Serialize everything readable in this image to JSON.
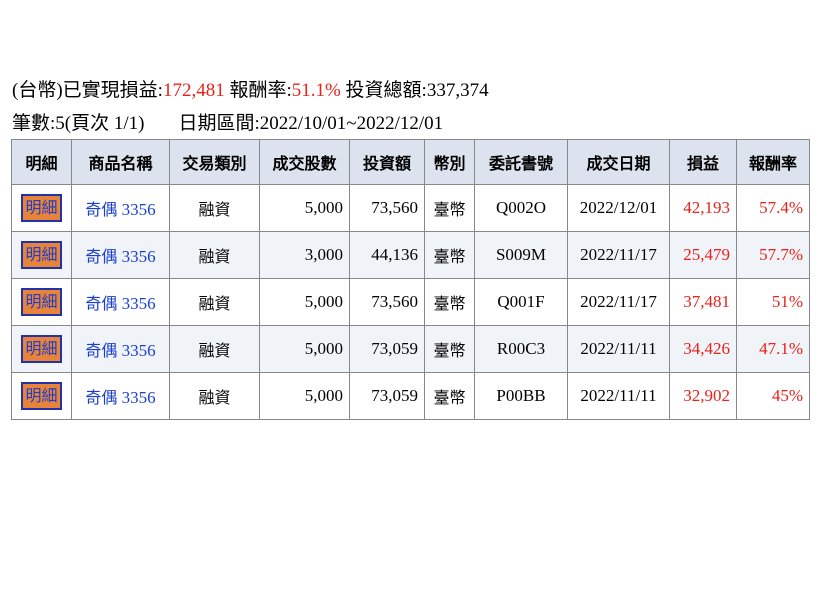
{
  "summary": {
    "realized_label": "(台幣)已實現損益:",
    "realized_value": "172,481",
    "return_label": " 報酬率:",
    "return_value": "51.1%",
    "invest_label": " 投資總額:",
    "invest_value": "337,374",
    "count_label": "筆數:5(頁次 1/1)",
    "period_label": "日期區間:2022/10/01~2022/12/01"
  },
  "table": {
    "headers": [
      "明細",
      "商品名稱",
      "交易類別",
      "成交股數",
      "投資額",
      "幣別",
      "委託書號",
      "成交日期",
      "損益",
      "報酬率"
    ],
    "rows": [
      {
        "detail": "明細",
        "product_name": "奇偶",
        "product_code": "3356",
        "type": "融資",
        "shares": "5,000",
        "amount": "73,560",
        "currency": "臺幣",
        "order_no": "Q002O",
        "date": "2022/12/01",
        "pnl": "42,193",
        "return": "57.4%"
      },
      {
        "detail": "明細",
        "product_name": "奇偶",
        "product_code": "3356",
        "type": "融資",
        "shares": "3,000",
        "amount": "44,136",
        "currency": "臺幣",
        "order_no": "S009M",
        "date": "2022/11/17",
        "pnl": "25,479",
        "return": "57.7%"
      },
      {
        "detail": "明細",
        "product_name": "奇偶",
        "product_code": "3356",
        "type": "融資",
        "shares": "5,000",
        "amount": "73,560",
        "currency": "臺幣",
        "order_no": "Q001F",
        "date": "2022/11/17",
        "pnl": "37,481",
        "return": "51%"
      },
      {
        "detail": "明細",
        "product_name": "奇偶",
        "product_code": "3356",
        "type": "融資",
        "shares": "5,000",
        "amount": "73,059",
        "currency": "臺幣",
        "order_no": "R00C3",
        "date": "2022/11/11",
        "pnl": "34,426",
        "return": "47.1%"
      },
      {
        "detail": "明細",
        "product_name": "奇偶",
        "product_code": "3356",
        "type": "融資",
        "shares": "5,000",
        "amount": "73,059",
        "currency": "臺幣",
        "order_no": "P00BB",
        "date": "2022/11/11",
        "pnl": "32,902",
        "return": "45%"
      }
    ]
  },
  "colors": {
    "header_bg": "#dde3ee",
    "profit_red": "#e8211a",
    "link_blue": "#1a3fcf",
    "detail_button_bg": "#e8833a"
  }
}
